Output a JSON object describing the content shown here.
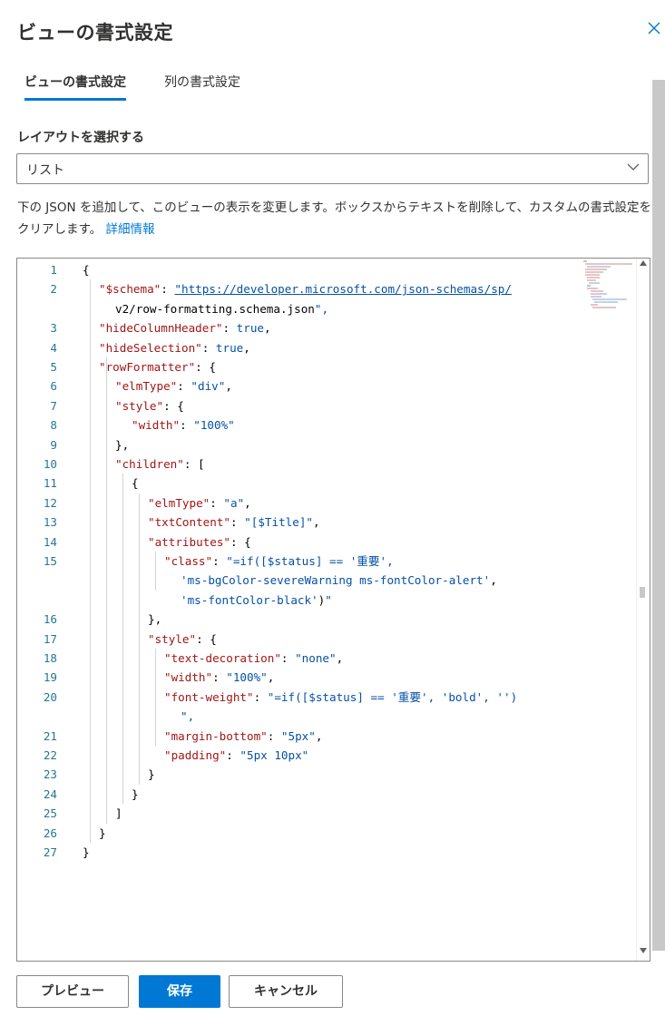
{
  "panel": {
    "title": "ビューの書式設定",
    "close_icon": "close-icon"
  },
  "tabs": [
    {
      "label": "ビューの書式設定",
      "selected": true
    },
    {
      "label": "列の書式設定",
      "selected": false
    }
  ],
  "layout_select": {
    "label": "レイアウトを選択する",
    "value": "リスト"
  },
  "description": {
    "text": "下の JSON を追加して、このビューの表示を変更します。ボックスからテキストを削除して、カスタムの書式設定をクリアします。",
    "link": "詳細情報"
  },
  "editor": {
    "line_numbers": [
      "1",
      "2",
      "",
      "3",
      "4",
      "5",
      "6",
      "7",
      "8",
      "9",
      "10",
      "11",
      "12",
      "13",
      "14",
      "15",
      "",
      "",
      "16",
      "17",
      "18",
      "19",
      "20",
      "",
      "21",
      "22",
      "23",
      "24",
      "25",
      "26",
      "27"
    ],
    "lines": [
      "{",
      "\"$schema\": \"https://developer.microsoft.com/json-schemas/sp/",
      "v2/row-formatting.schema.json\",",
      "\"hideColumnHeader\": true,",
      "\"hideSelection\": true,",
      "\"rowFormatter\": {",
      "\"elmType\": \"div\",",
      "\"style\": {",
      "\"width\": \"100%\"",
      "},",
      "\"children\": [",
      "{",
      "\"elmType\": \"a\",",
      "\"txtContent\": \"[$Title]\",",
      "\"attributes\": {",
      "\"class\": \"=if([$status] == '重要',",
      "'ms-bgColor-severeWarning ms-fontColor-alert',",
      "'ms-fontColor-black')\"",
      "},",
      "\"style\": {",
      "\"text-decoration\": \"none\",",
      "\"width\": \"100%\",",
      "\"font-weight\": \"=if([$status] == '重要', 'bold', '')",
      "\",",
      "\"margin-bottom\": \"5px\",",
      "\"padding\": \"5px 10px\"",
      "}",
      "}",
      "]",
      "}",
      "}"
    ]
  },
  "buttons": {
    "preview": "プレビュー",
    "save": "保存",
    "cancel": "キャンセル"
  },
  "colors": {
    "accent": "#0078d4",
    "json_key": "#a31515",
    "json_value": "#0451a5"
  }
}
